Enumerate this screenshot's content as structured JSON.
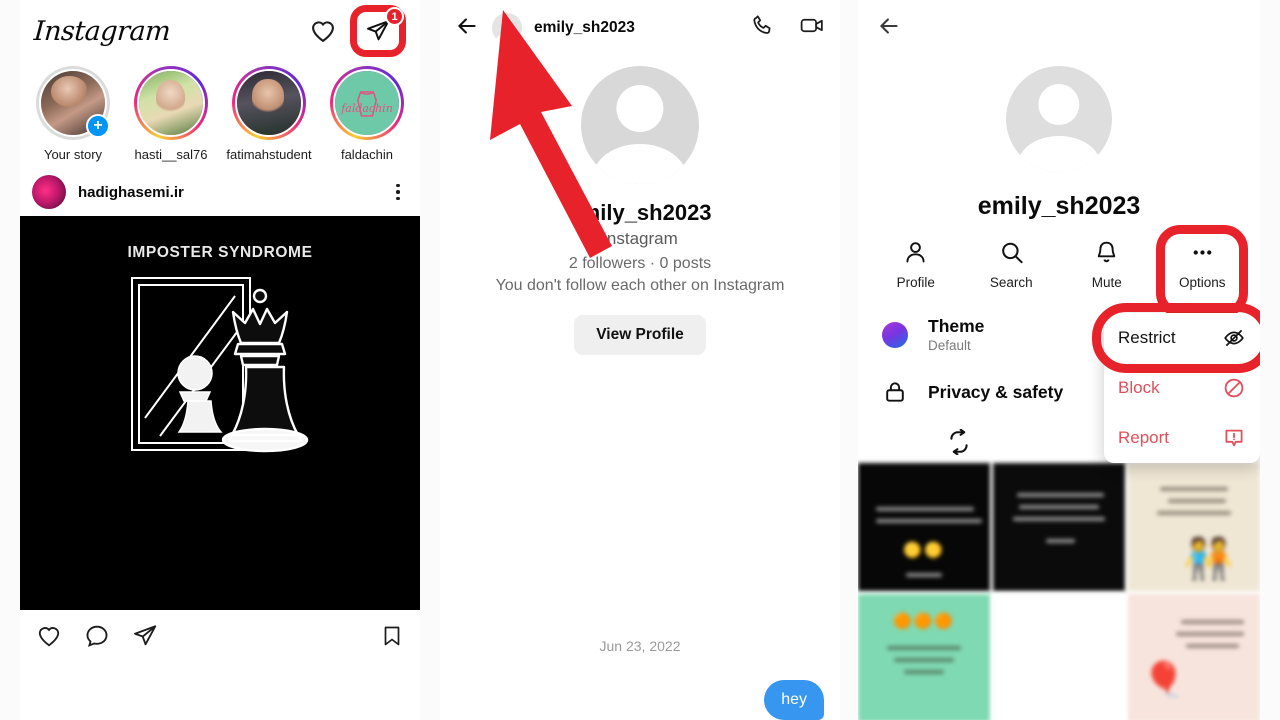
{
  "feed": {
    "app_name": "Instagram",
    "icons": {
      "heart": "heart-icon",
      "direct": "paper-plane-icon"
    },
    "dm_badge_count": "1",
    "stories": [
      {
        "name": "Your story",
        "has_add_badge": true
      },
      {
        "name": "hasti__sal76",
        "has_add_badge": false
      },
      {
        "name": "fatimahstudent",
        "has_add_badge": false
      },
      {
        "name": "faldachin",
        "has_add_badge": false,
        "logo_text": "faldachin"
      }
    ],
    "post": {
      "username": "hadighasemi.ir",
      "image_caption": "IMPOSTER SYNDROME",
      "actions": [
        "like-icon",
        "comment-icon",
        "share-icon",
        "bookmark-icon"
      ]
    }
  },
  "chat": {
    "back": "back-arrow-icon",
    "title": "emily_sh2023",
    "call_icon": "phone-icon",
    "video_icon": "video-camera-icon",
    "profile": {
      "name": "emily_sh2023",
      "platform": "Instagram",
      "stats": "2 followers · 0 posts",
      "note": "You don't follow each other on Instagram",
      "view_profile_label": "View Profile"
    },
    "date_divider": "Jun 23, 2022",
    "message": "hey"
  },
  "details": {
    "back": "back-arrow-icon",
    "name": "emily_sh2023",
    "quick_actions": [
      {
        "label": "Profile",
        "icon": "person-icon",
        "highlighted": false
      },
      {
        "label": "Search",
        "icon": "search-icon",
        "highlighted": false
      },
      {
        "label": "Mute",
        "icon": "bell-icon",
        "highlighted": false
      },
      {
        "label": "Options",
        "icon": "ellipsis-icon",
        "highlighted": true
      }
    ],
    "settings": [
      {
        "title": "Theme",
        "sub": "Default",
        "icon": "theme-color-dot"
      },
      {
        "title": "Privacy & safety",
        "sub": "",
        "icon": "lock-icon"
      }
    ],
    "menu": [
      {
        "label": "Restrict",
        "icon": "restrict-eye-off-icon",
        "danger": false,
        "highlighted": true
      },
      {
        "label": "Block",
        "icon": "block-circle-slash-icon",
        "danger": true,
        "highlighted": false
      },
      {
        "label": "Report",
        "icon": "report-exclamation-icon",
        "danger": true,
        "highlighted": false
      }
    ],
    "media_tabs": [
      {
        "icon": "loop-arrows-icon"
      },
      {
        "icon": "reels-icon"
      }
    ]
  },
  "annotations": {
    "arrow_color": "#e8222a",
    "highlight_color": "#e8222a",
    "arrow_target": "chat-header-avatar"
  }
}
